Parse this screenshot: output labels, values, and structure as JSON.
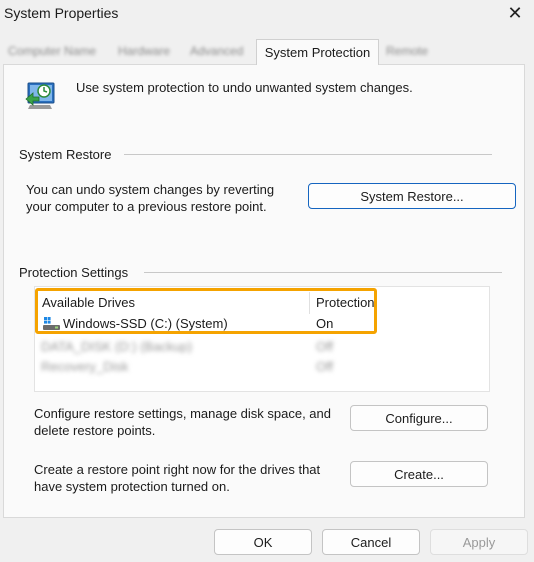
{
  "window": {
    "title": "System Properties",
    "close_glyph": "✕"
  },
  "tabs": [
    {
      "label": "Computer Name"
    },
    {
      "label": "Hardware"
    },
    {
      "label": "Advanced"
    },
    {
      "label": "System Protection",
      "active": true
    },
    {
      "label": "Remote"
    }
  ],
  "intro": {
    "text": "Use system protection to undo unwanted system changes.",
    "icon": "computer-restore-icon"
  },
  "system_restore": {
    "heading": "System Restore",
    "description": "You can undo system changes by reverting your computer to a previous restore point.",
    "button_label": "System Restore..."
  },
  "protection": {
    "heading": "Protection Settings",
    "columns": {
      "drive": "Available Drives",
      "protection": "Protection"
    },
    "drives": [
      {
        "name": "Windows-SSD (C:) (System)",
        "status": "On",
        "icon": "windows-drive-icon"
      }
    ],
    "blurred_rows": [
      {
        "name": "DATA_DISK (D:) (Backup)",
        "status": "Off"
      },
      {
        "name": "Recovery_Disk",
        "status": "Off"
      }
    ],
    "configure": {
      "description": "Configure restore settings, manage disk space, and delete restore points.",
      "button_label": "Configure..."
    },
    "create": {
      "description": "Create a restore point right now for the drives that have system protection turned on.",
      "button_label": "Create..."
    }
  },
  "footer": {
    "ok_label": "OK",
    "cancel_label": "Cancel",
    "apply_label": "Apply"
  },
  "colors": {
    "highlight": "#f5a300",
    "primary_border": "#1565c0"
  }
}
